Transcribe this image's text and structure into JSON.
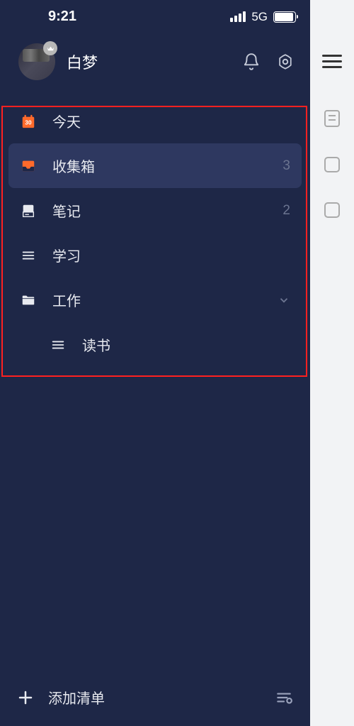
{
  "status_bar": {
    "time": "9:21",
    "network": "5G"
  },
  "user": {
    "name": "白梦"
  },
  "nav": {
    "today": {
      "label": "今天"
    },
    "inbox": {
      "label": "收集箱",
      "count": "3"
    },
    "notes": {
      "label": "笔记",
      "count": "2"
    },
    "study": {
      "label": "学习"
    },
    "work": {
      "label": "工作"
    },
    "reading": {
      "label": "读书"
    }
  },
  "bottom": {
    "add_list": "添加清单"
  },
  "colors": {
    "accent": "#ff6a2b",
    "bg": "#1e2747",
    "selected": "#2e3860"
  }
}
